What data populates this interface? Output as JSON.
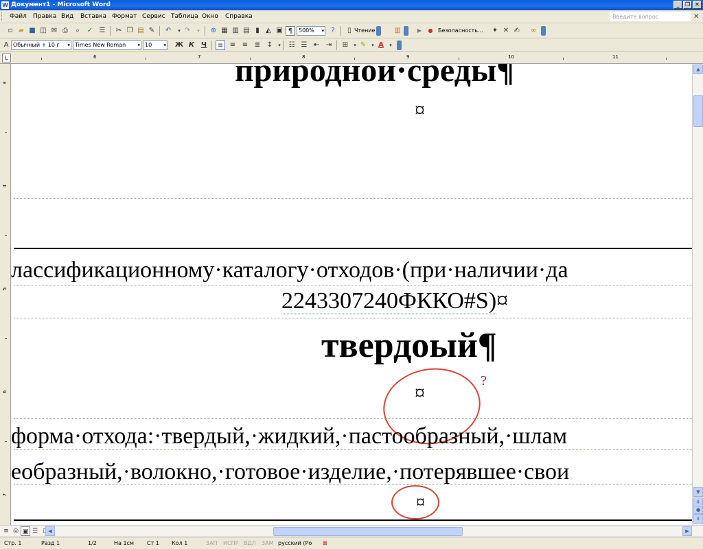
{
  "window": {
    "title": "Документ1 - Microsoft Word",
    "app_icon": "W"
  },
  "menu": {
    "items": [
      "Файл",
      "Правка",
      "Вид",
      "Вставка",
      "Формат",
      "Сервис",
      "Таблица",
      "Окно",
      "Справка"
    ],
    "help_placeholder": "Введите вопрос"
  },
  "toolbar": {
    "zoom": "500%",
    "reading_label": "Чтение",
    "security_label": "Безопасность...",
    "style": "Обычный + 10 г",
    "font": "Times New Roman",
    "size": "10",
    "bold": "Ж",
    "italic": "К",
    "underline": "Ч"
  },
  "ruler": {
    "numbers": [
      "6",
      "7",
      "8",
      "9",
      "10",
      "11"
    ]
  },
  "vruler": {
    "numbers": [
      "3",
      "4",
      "5",
      "6",
      "7"
    ]
  },
  "document": {
    "line1": "природной·среды¶",
    "cell_mark": "¤",
    "line2": "лассификационному·каталогу·отходов·(при·наличии·да",
    "line3a": "2243307240ФККО#S)",
    "line3b": "¤",
    "line4": "твердоый¶",
    "question": "?",
    "line5": "форма·отхода:·твердый,·жидкий,·пастообразный,·шлам",
    "line6": "еобразный,·волокно,·готовое·изделие,·потерявшее·свои"
  },
  "status": {
    "page": "Стр. 1",
    "section": "Разд 1",
    "pages": "1/2",
    "at": "На 1см",
    "line": "Ст 1",
    "col": "Кол 1",
    "rec": "ЗАП",
    "trk": "ИСПР",
    "ext": "ВДЛ",
    "ovr": "ЗАМ",
    "lang": "русский (Ро"
  },
  "colors": {
    "annotation": "#d8453a",
    "title_bar": "#0a5ee0"
  }
}
